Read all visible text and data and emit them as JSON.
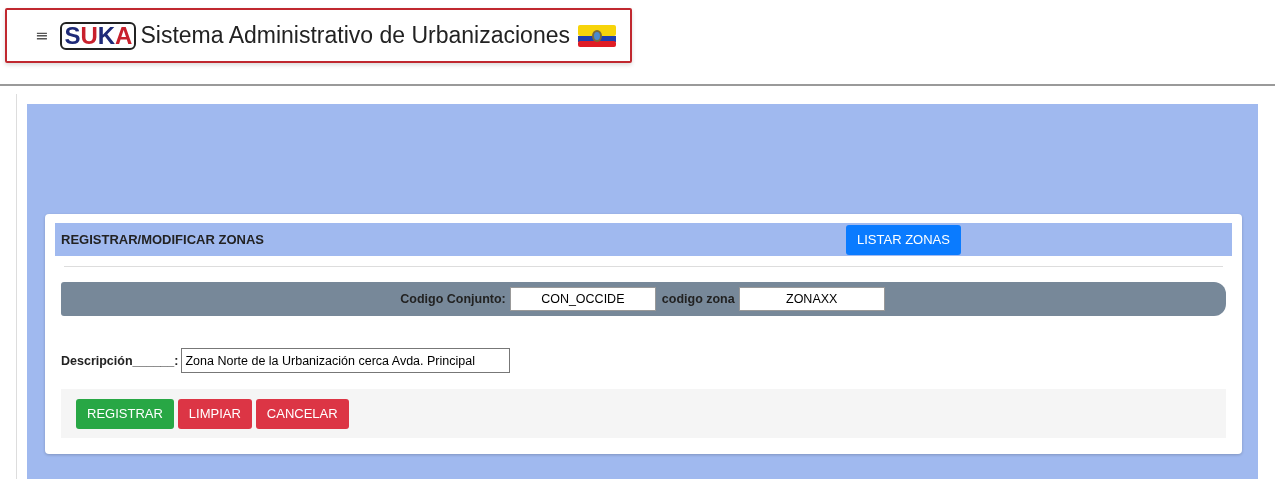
{
  "header": {
    "menu_icon": "≡",
    "logo": "SUKA",
    "title": "Sistema Administrativo de Urbanizaciones"
  },
  "card": {
    "title": "REGISTRAR/MODIFICAR ZONAS",
    "list_button": "LISTAR ZONAS",
    "codes": [
      {
        "label": "Codigo Conjunto:",
        "value": "CON_OCCIDE"
      },
      {
        "label": "codigo zona",
        "value": "ZONAXX"
      }
    ],
    "description": {
      "label": "Descripción______:",
      "value": "Zona Norte de la Urbanización cerca Avda. Principal"
    },
    "buttons": [
      {
        "label": "REGISTRAR",
        "kind": "success"
      },
      {
        "label": "LIMPIAR",
        "kind": "danger"
      },
      {
        "label": "CANCELAR",
        "kind": "danger"
      }
    ]
  }
}
